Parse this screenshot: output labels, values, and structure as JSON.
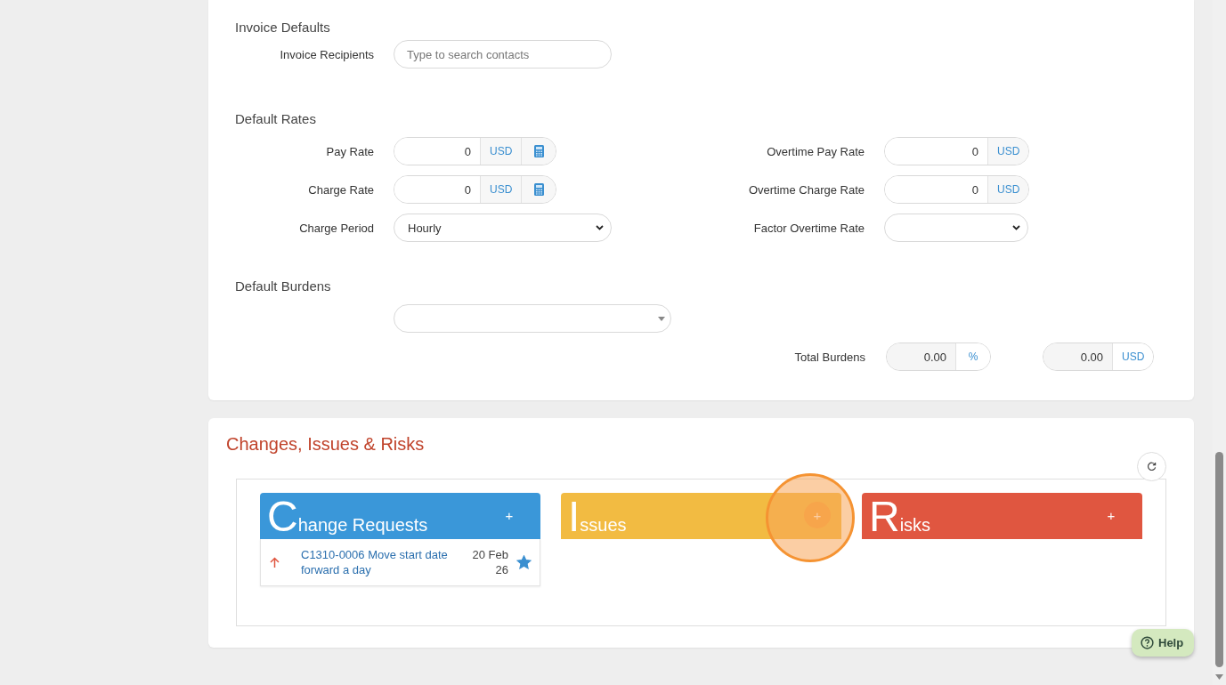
{
  "invoice_defaults": {
    "heading": "Invoice Defaults",
    "fields": [
      {
        "kind": "search",
        "label": "Invoice Recipients",
        "placeholder": "Type to search contacts"
      }
    ]
  },
  "default_rates": {
    "heading": "Default Rates",
    "left": [
      {
        "kind": "money",
        "label": "Pay Rate",
        "value": "0",
        "unit": "USD",
        "calculator": true
      },
      {
        "kind": "money",
        "label": "Charge Rate",
        "value": "0",
        "unit": "USD",
        "calculator": true
      },
      {
        "kind": "select",
        "label": "Charge Period",
        "value": "Hourly"
      }
    ],
    "right": [
      {
        "kind": "money",
        "label": "Overtime Pay Rate",
        "value": "0",
        "unit": "USD",
        "calculator": false
      },
      {
        "kind": "money",
        "label": "Overtime Charge Rate",
        "value": "0",
        "unit": "USD",
        "calculator": false
      },
      {
        "kind": "select",
        "label": "Factor Overtime Rate"
      }
    ]
  },
  "default_burdens": {
    "heading": "Default Burdens",
    "total_label": "Total Burdens",
    "totals": [
      {
        "value": "0.00",
        "unit": "%"
      },
      {
        "value": "0.00",
        "unit": "USD"
      }
    ]
  },
  "changes_issues_risks": {
    "title": "Changes, Issues & Risks",
    "panels": [
      {
        "title": "Change Requests",
        "color": "#3a97d9",
        "add": "+",
        "highlighted": false,
        "items": [
          {
            "text": "C1310-0006 Move start date forward a day",
            "date": "20 Feb 26",
            "starred": true
          }
        ]
      },
      {
        "title": "Issues",
        "color": "#f2bb42",
        "add": "+",
        "highlighted": true
      },
      {
        "title": "Risks",
        "color": "#e05640",
        "add": "+",
        "highlighted": false
      }
    ]
  },
  "help": {
    "label": "Help"
  }
}
